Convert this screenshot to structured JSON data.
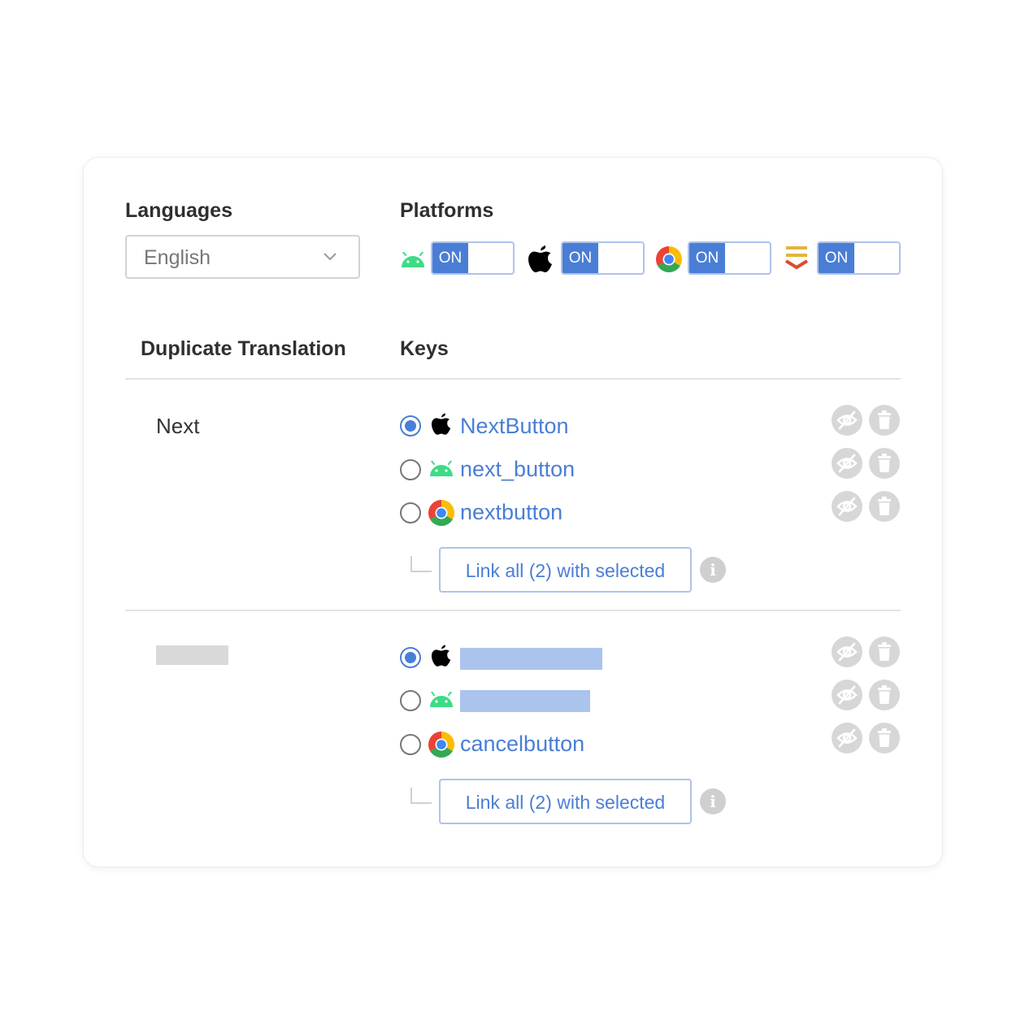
{
  "settings": {
    "languages_label": "Languages",
    "language_value": "English",
    "platforms_label": "Platforms",
    "platforms": [
      {
        "icon": "android-icon",
        "toggle": "ON"
      },
      {
        "icon": "apple-icon",
        "toggle": "ON"
      },
      {
        "icon": "chrome-icon",
        "toggle": "ON"
      },
      {
        "icon": "stack-icon",
        "toggle": "ON"
      }
    ]
  },
  "table": {
    "col_translation": "Duplicate Translation",
    "col_keys": "Keys",
    "groups": [
      {
        "translation": "Next",
        "keys": [
          {
            "platform": "apple-icon",
            "name": "NextButton",
            "selected": true
          },
          {
            "platform": "android-icon",
            "name": "next_button",
            "selected": false
          },
          {
            "platform": "chrome-icon",
            "name": "nextbutton",
            "selected": false
          }
        ],
        "link_label": "Link all (2) with selected"
      },
      {
        "translation": "",
        "keys": [
          {
            "platform": "apple-icon",
            "name": "",
            "selected": true
          },
          {
            "platform": "android-icon",
            "name": "",
            "selected": false
          },
          {
            "platform": "chrome-icon",
            "name": "cancelbutton",
            "selected": false
          }
        ],
        "link_label": "Link all (2) with selected"
      }
    ]
  },
  "colors": {
    "accent": "#4a7ed6",
    "android": "#3ddc84",
    "muted": "#d7d7d7"
  }
}
